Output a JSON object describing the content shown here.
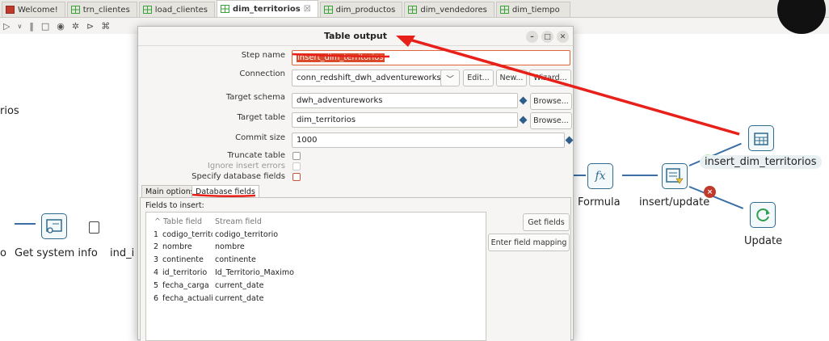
{
  "tabs": [
    {
      "label": "Welcome!",
      "icon": "red"
    },
    {
      "label": "trn_clientes",
      "icon": "grid"
    },
    {
      "label": "load_clientes",
      "icon": "grid"
    },
    {
      "label": "dim_territorios",
      "icon": "grid",
      "close": "☒"
    },
    {
      "label": "dim_productos",
      "icon": "grid"
    },
    {
      "label": "dim_vendedores",
      "icon": "grid"
    },
    {
      "label": "dim_tiempo",
      "icon": "grid"
    }
  ],
  "canvas": {
    "left_partial_label": "rios",
    "get_system_info": "Get system info",
    "partial_prefix": "o",
    "ind_label": "ind_i",
    "formula_label": "Formula",
    "insert_update_label": "insert/update",
    "insert_dim_label": "insert_dim_territorios",
    "update_label": "Update"
  },
  "dialog": {
    "title": "Table output",
    "step_name_label": "Step name",
    "step_name_value": "insert_dim_territorios",
    "connection_label": "Connection",
    "connection_value": "conn_redshift_dwh_adventureworks",
    "edit_btn": "Edit...",
    "new_btn": "New...",
    "wizard_btn": "Wizard...",
    "target_schema_label": "Target schema",
    "target_schema_value": "dwh_adventureworks",
    "browse_btn": "Browse...",
    "target_table_label": "Target table",
    "target_table_value": "dim_territorios",
    "commit_size_label": "Commit size",
    "commit_size_value": "1000",
    "truncate_label": "Truncate table",
    "ignore_errors_label": "Ignore insert errors",
    "specify_fields_label": "Specify database fields",
    "tab_main": "Main options",
    "tab_db": "Database fields",
    "fields_to_insert": "Fields to insert:",
    "col_table_field": "Table field",
    "col_stream_field": "Stream field",
    "rows": [
      {
        "n": "1",
        "table": "codigo_territorio",
        "stream": "codigo_territorio"
      },
      {
        "n": "2",
        "table": "nombre",
        "stream": "nombre"
      },
      {
        "n": "3",
        "table": "continente",
        "stream": "continente"
      },
      {
        "n": "4",
        "table": "id_territorio",
        "stream": "Id_Territorio_Maximo"
      },
      {
        "n": "5",
        "table": "fecha_carga",
        "stream": "current_date"
      },
      {
        "n": "6",
        "table": "fecha_actualizacion",
        "stream": "current_date"
      }
    ],
    "get_fields_btn": "Get fields",
    "enter_mapping_btn": "Enter field mapping"
  },
  "colors": {
    "annotation_red": "#e8201a",
    "accent_blue": "#2f5e8c"
  }
}
